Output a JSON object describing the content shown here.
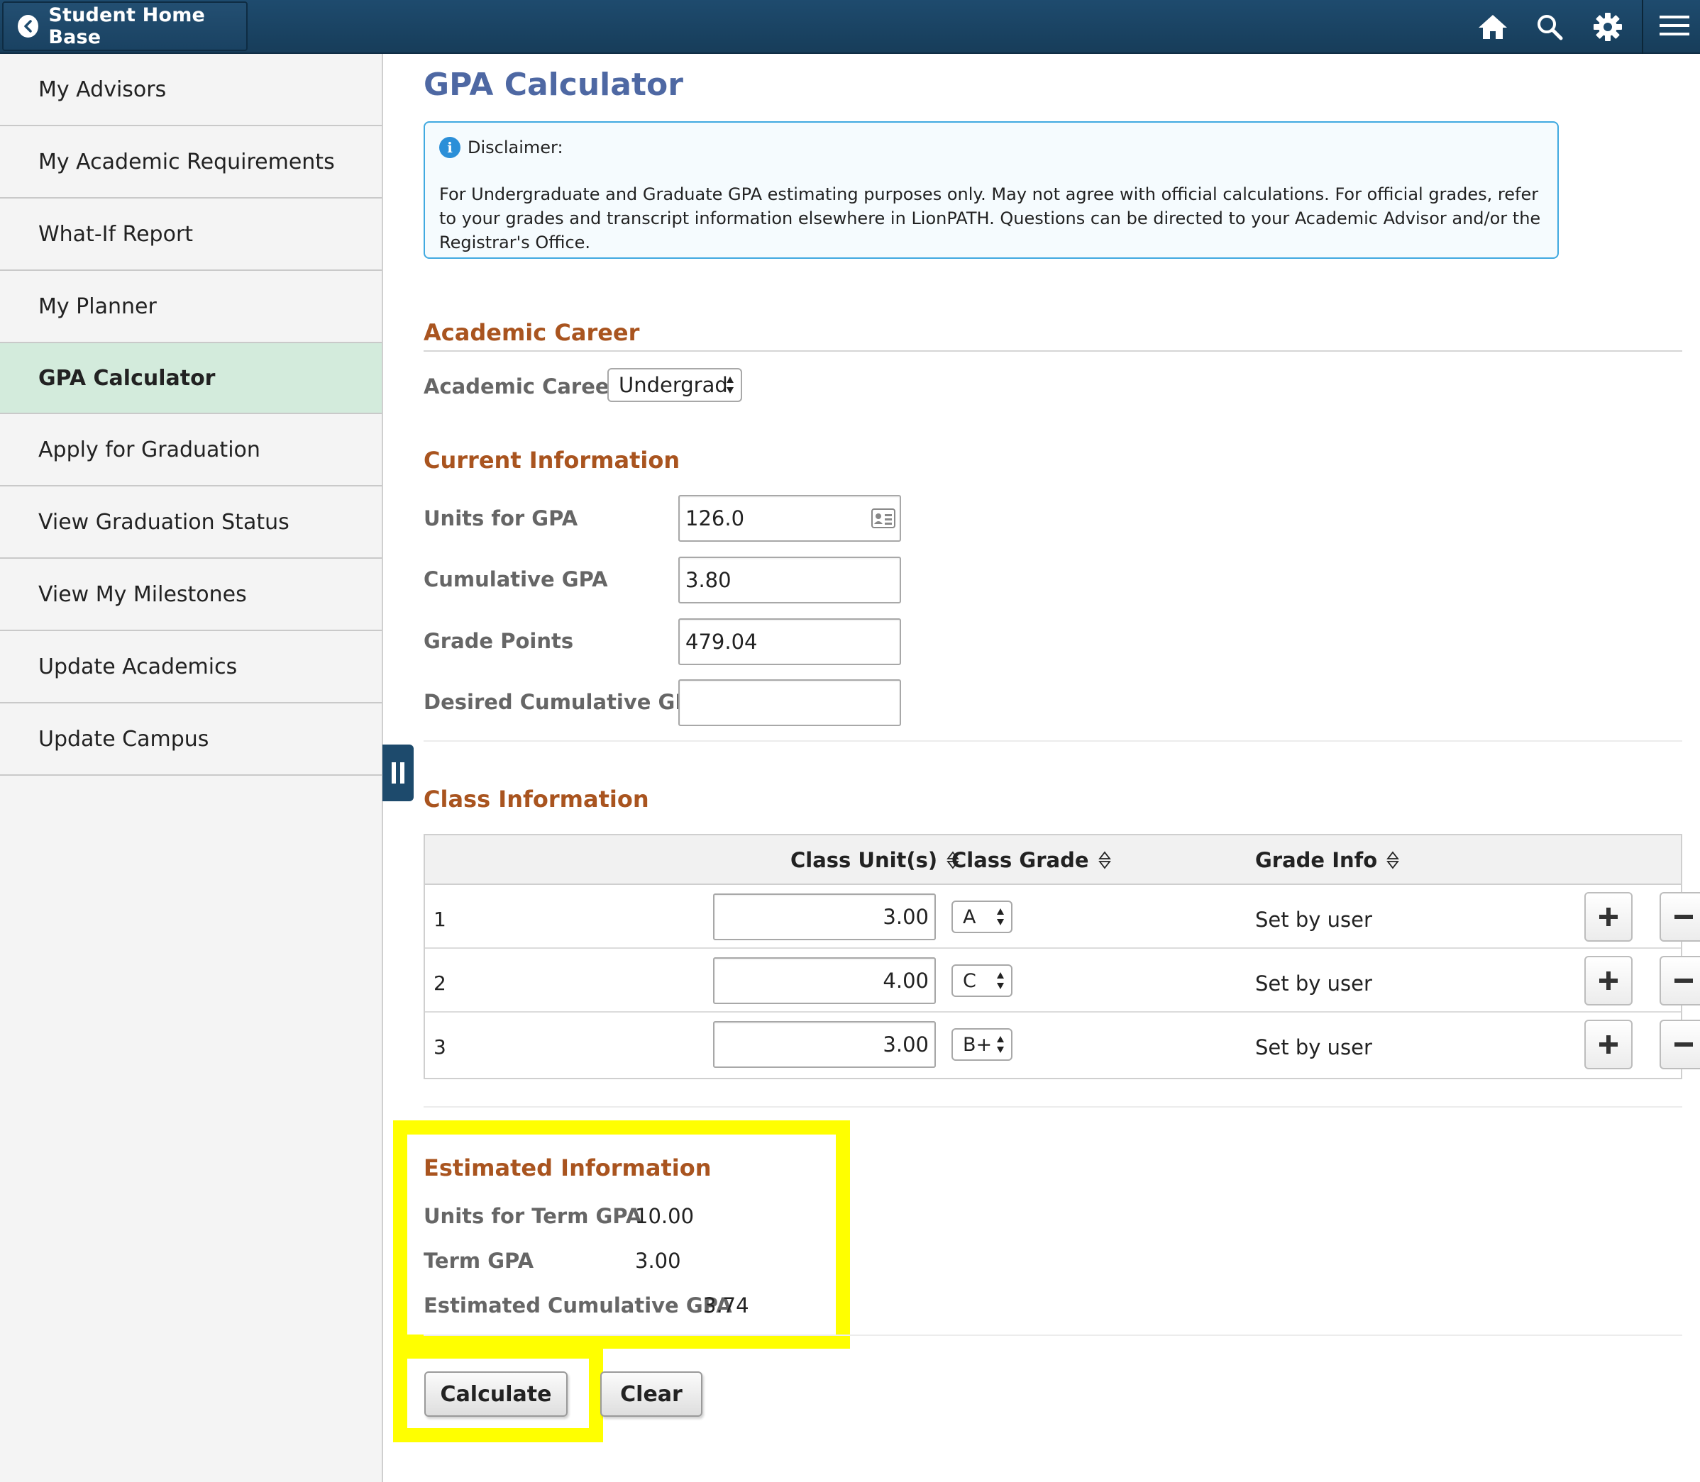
{
  "topbar": {
    "home_base_label": "Student Home Base",
    "icons": [
      "home-icon",
      "search-icon",
      "gear-icon",
      "menu-icon"
    ]
  },
  "sidebar": {
    "items": [
      {
        "label": "My Advisors",
        "active": false
      },
      {
        "label": "My Academic Requirements",
        "active": false
      },
      {
        "label": "What-If Report",
        "active": false
      },
      {
        "label": "My Planner",
        "active": false
      },
      {
        "label": "GPA Calculator",
        "active": true
      },
      {
        "label": "Apply for Graduation",
        "active": false
      },
      {
        "label": "View Graduation Status",
        "active": false
      },
      {
        "label": "View My Milestones",
        "active": false
      },
      {
        "label": "Update Academics",
        "active": false
      },
      {
        "label": "Update Campus",
        "active": false
      }
    ]
  },
  "page": {
    "title": "GPA Calculator"
  },
  "disclaimer": {
    "heading": "Disclaimer:",
    "text": "For Undergraduate and Graduate GPA estimating purposes only. May not agree with official calculations. For official grades, refer to your grades and transcript information elsewhere in LionPATH. Questions can be directed to your Academic Advisor and/or the Registrar's Office."
  },
  "academic_career": {
    "section": "Academic Career",
    "label": "Academic Career",
    "value": "Undergrad"
  },
  "current_info": {
    "section": "Current Information",
    "units_label": "Units for GPA",
    "units_value": "126.0",
    "cum_gpa_label": "Cumulative GPA",
    "cum_gpa_value": "3.80",
    "grade_points_label": "Grade Points",
    "grade_points_value": "479.04",
    "desired_label": "Desired Cumulative GPA",
    "desired_value": ""
  },
  "class_info": {
    "section": "Class Information",
    "columns": {
      "units": "Class Unit(s)",
      "grade": "Class Grade",
      "info": "Grade Info"
    },
    "rows": [
      {
        "num": "1",
        "units": "3.00",
        "grade": "A",
        "info": "Set by user"
      },
      {
        "num": "2",
        "units": "4.00",
        "grade": "C",
        "info": "Set by user"
      },
      {
        "num": "3",
        "units": "3.00",
        "grade": "B+",
        "info": "Set by user"
      }
    ]
  },
  "estimated": {
    "section": "Estimated Information",
    "units_label": "Units for Term GPA",
    "units_value": "10.00",
    "term_gpa_label": "Term GPA",
    "term_gpa_value": "3.00",
    "est_cum_label": "Estimated Cumulative GPA",
    "est_cum_value": "3.74"
  },
  "actions": {
    "calculate": "Calculate",
    "clear": "Clear"
  },
  "colors": {
    "topbar": "#1e4b6e",
    "title": "#4e68a3",
    "section_heading": "#a9541f",
    "active_nav": "#d3ebdc",
    "highlight": "#ffff00"
  }
}
